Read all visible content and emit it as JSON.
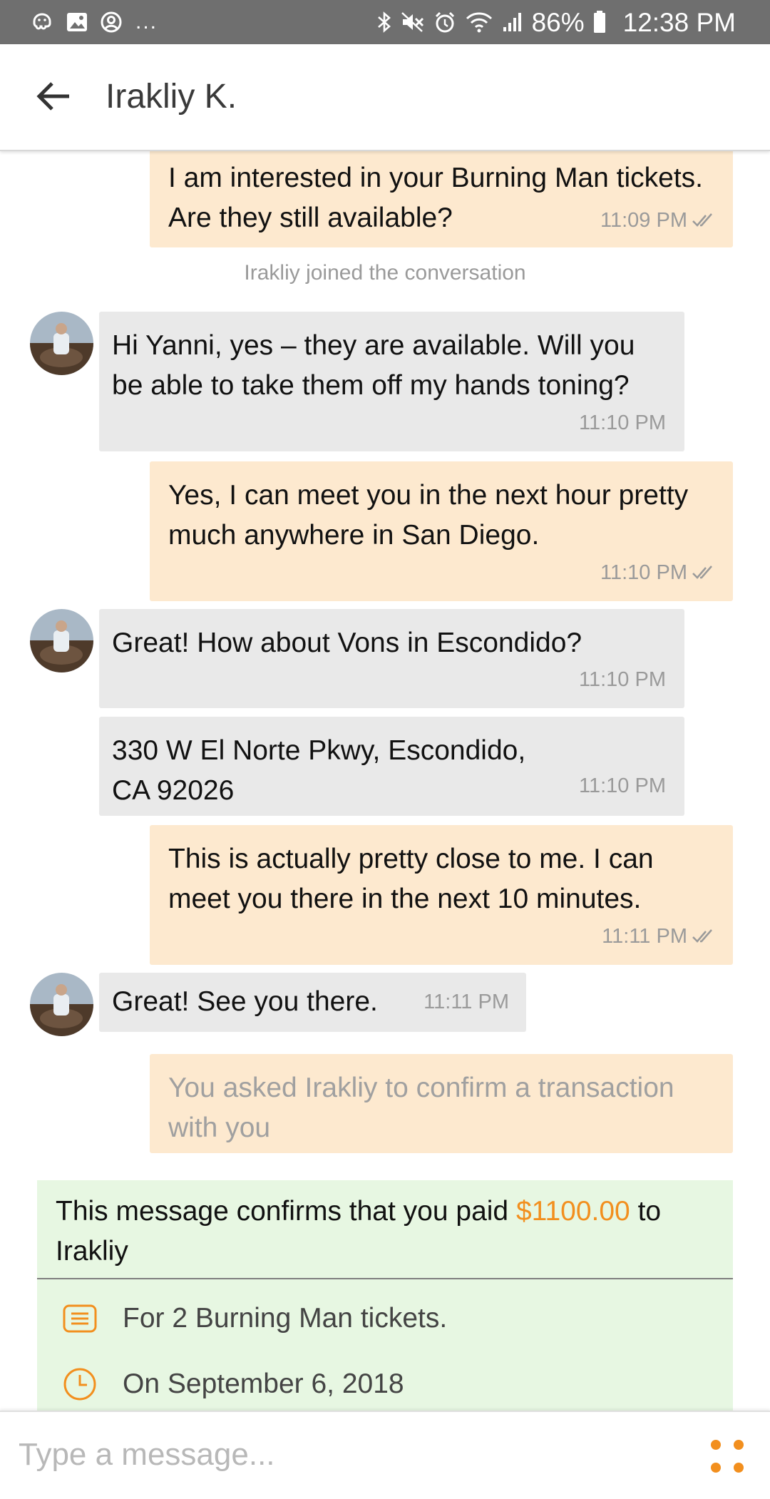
{
  "status_bar": {
    "overflow_indicator": "...",
    "battery": "86%",
    "time": "12:38 PM",
    "icons": [
      "waze-icon",
      "gallery-icon",
      "account-icon",
      "bluetooth-icon",
      "mute-icon",
      "alarm-icon",
      "wifi-icon",
      "signal-icon",
      "battery-icon"
    ],
    "color": "#6f6f6f"
  },
  "header": {
    "back_icon": "arrow-back-icon",
    "contact_name": "Irakliy K."
  },
  "messages": [
    {
      "direction": "outgoing",
      "text": "I am interested in your Burning Man tickets. Are they still available?",
      "time": "11:09 PM",
      "status": "read"
    },
    {
      "type": "system",
      "text": "Irakliy joined the conversation"
    },
    {
      "direction": "incoming",
      "text": "Hi Yanni, yes – they are available. Will you be able to take them off my hands toning?",
      "time": "11:10 PM"
    },
    {
      "direction": "outgoing",
      "text": "Yes, I can meet you in the next hour pretty much anywhere in San Diego.",
      "time": "11:10 PM",
      "status": "read"
    },
    {
      "direction": "incoming",
      "text": "Great! How about Vons in Escondido?",
      "time": "11:10 PM"
    },
    {
      "direction": "incoming",
      "text": "330 W El Norte Pkwy, Escondido, CA 92026",
      "time": "11:10 PM"
    },
    {
      "direction": "outgoing",
      "text": "This is actually pretty close to me. I can meet you there in the next 10 minutes.",
      "time": "11:11 PM",
      "status": "read"
    },
    {
      "direction": "incoming",
      "text": "Great! See you there.",
      "time": "11:11 PM"
    },
    {
      "direction": "outgoing",
      "type": "notice",
      "text": "You asked Irakliy to confirm a transaction with you"
    }
  ],
  "confirmation": {
    "text_before": "This message confirms that you paid ",
    "amount": "$1100.00",
    "text_after": " to Irakliy",
    "details": [
      {
        "icon": "note-icon",
        "text": "For 2 Burning Man tickets."
      },
      {
        "icon": "clock-icon",
        "text": "On September 6, 2018"
      }
    ]
  },
  "composer": {
    "placeholder": "Type a message...",
    "menu_icon": "dots-grid-icon"
  },
  "colors": {
    "outgoing_bubble": "#fde9cf",
    "incoming_bubble": "#e9e9e9",
    "confirmation_bg": "#e7f7e2",
    "accent": "#f28f1e",
    "timestamp": "#9a9a9a"
  }
}
